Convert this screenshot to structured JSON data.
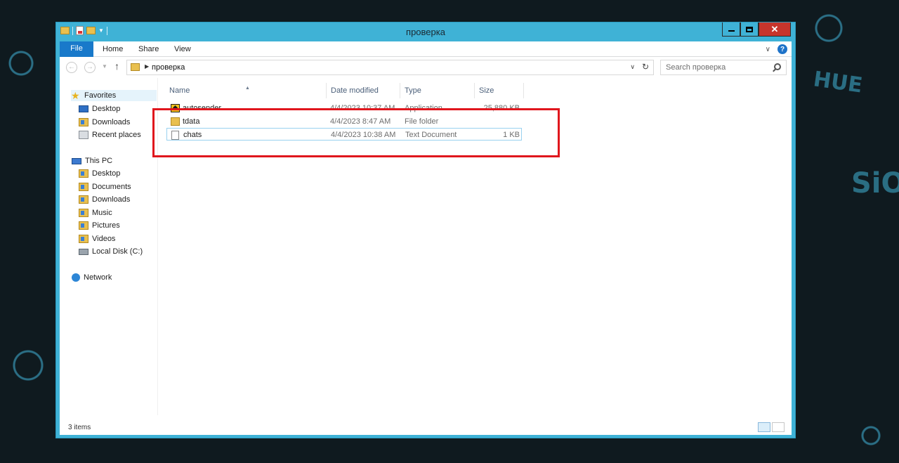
{
  "window": {
    "title": "проверка"
  },
  "ribbon": {
    "file": "File",
    "home": "Home",
    "share": "Share",
    "view": "View"
  },
  "address": {
    "path": "проверка",
    "search_placeholder": "Search проверка"
  },
  "nav": {
    "favorites": "Favorites",
    "favorites_items": [
      "Desktop",
      "Downloads",
      "Recent places"
    ],
    "this_pc": "This PC",
    "pc_items": [
      "Desktop",
      "Documents",
      "Downloads",
      "Music",
      "Pictures",
      "Videos",
      "Local Disk (C:)"
    ],
    "network": "Network"
  },
  "columns": {
    "name": "Name",
    "date": "Date modified",
    "type": "Type",
    "size": "Size"
  },
  "files": [
    {
      "name": "autosender",
      "date": "4/4/2023 10:37 AM",
      "type": "Application",
      "size": "25,880 KB",
      "icon": "application-icon"
    },
    {
      "name": "tdata",
      "date": "4/4/2023 8:47 AM",
      "type": "File folder",
      "size": "",
      "icon": "folder-icon"
    },
    {
      "name": "chats",
      "date": "4/4/2023 10:38 AM",
      "type": "Text Document",
      "size": "1 KB",
      "icon": "text-document-icon"
    }
  ],
  "status": {
    "items": "3 items"
  },
  "colors": {
    "accent": "#1979ca",
    "frame": "#3fb2d6",
    "highlight": "#e0161d",
    "close": "#c7352c"
  },
  "wallpaper": {
    "text1": "HUE",
    "text2": "SiO"
  }
}
